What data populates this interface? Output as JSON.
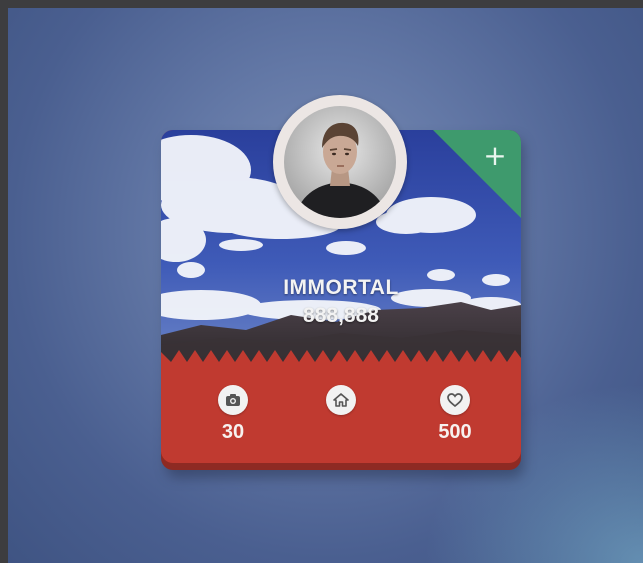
{
  "profile": {
    "name": "IMMORTAL",
    "score": "888,888"
  },
  "stats": [
    {
      "icon": "camera-icon",
      "value": "30"
    },
    {
      "icon": "home-icon",
      "value": ""
    },
    {
      "icon": "heart-icon",
      "value": "500"
    }
  ],
  "corner": {
    "icon": "plus-icon",
    "symbol": "+"
  },
  "colors": {
    "card_red": "#c03a30",
    "corner_green": "#3e9a6d",
    "background_blue": "#6378a6"
  }
}
